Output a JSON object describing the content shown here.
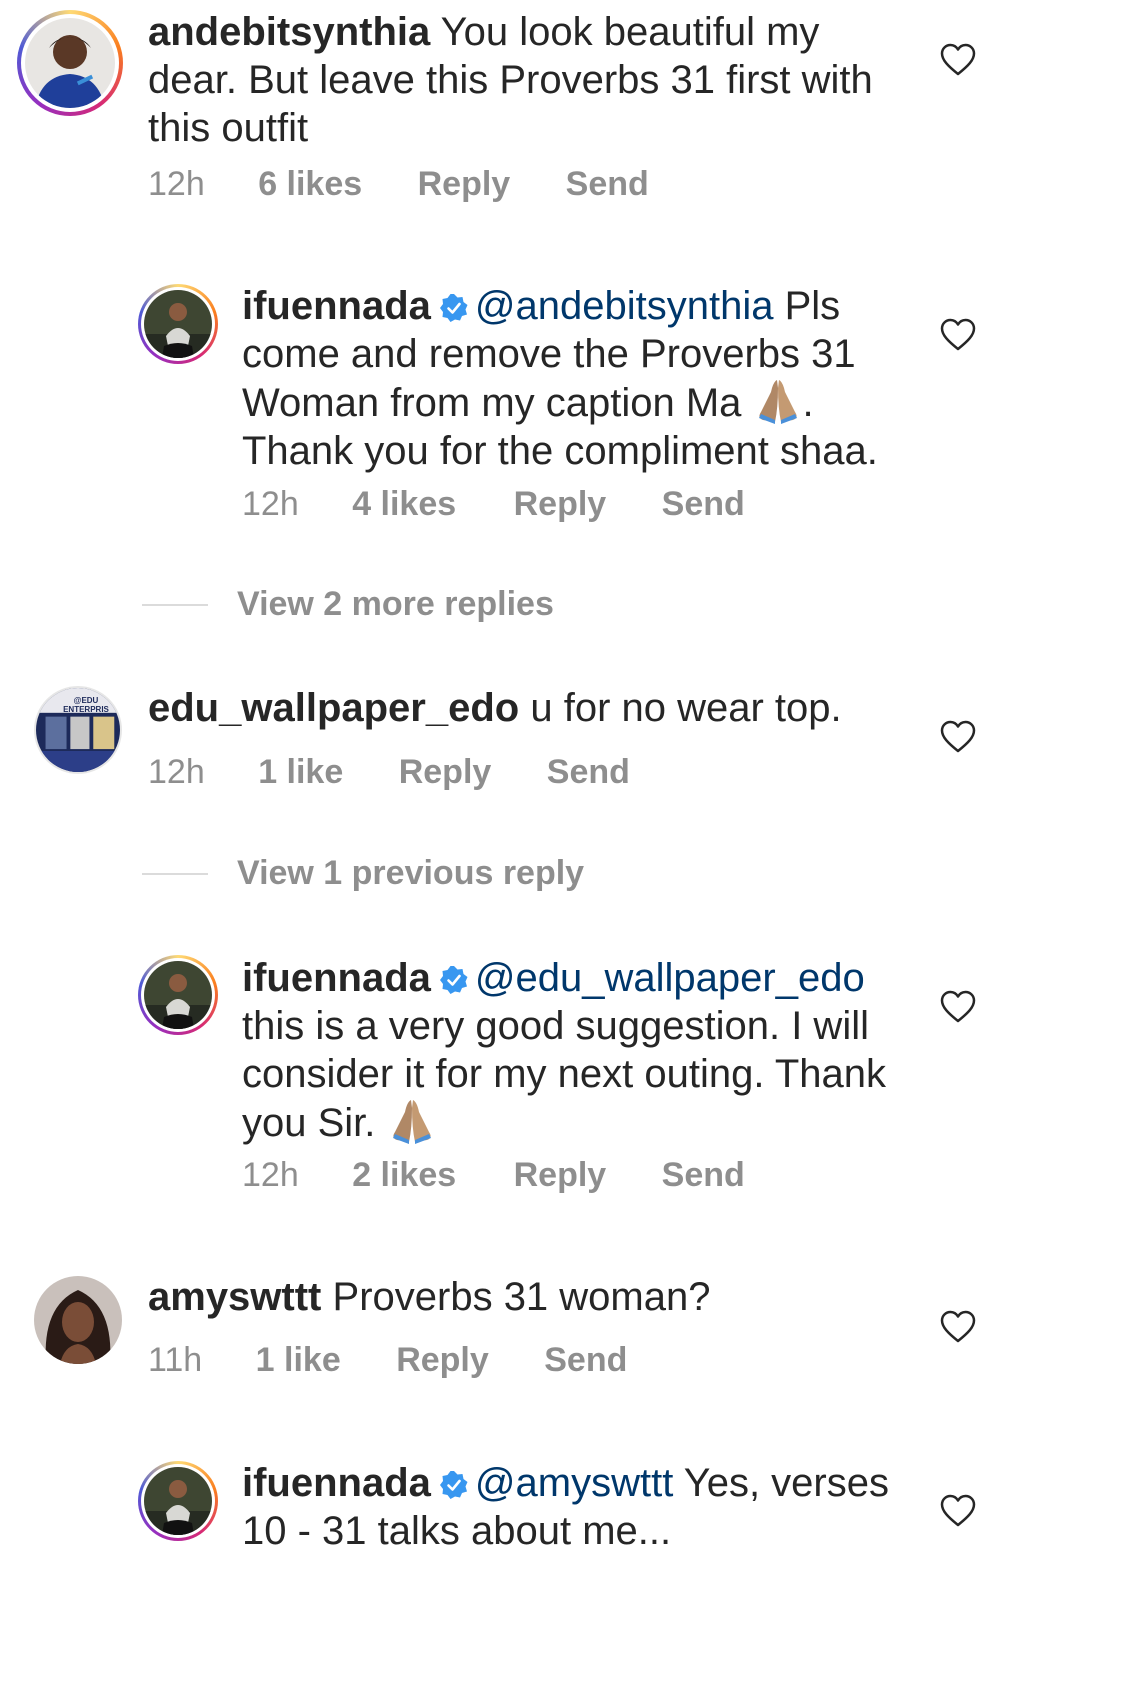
{
  "comments": [
    {
      "username": "andebitsynthia",
      "text": "You look beautiful my dear. But leave this Proverbs 31 first with this outfit",
      "time": "12h",
      "likes": "6 likes",
      "reply": "Reply",
      "send": "Send"
    },
    {
      "username": "ifuennada",
      "mention": "@andebitsynthia",
      "text_a": "Pls come and remove the Proverbs 31 Woman from my caption Ma",
      "text_b": ". Thank you for the compliment shaa.",
      "time": "12h",
      "likes": "4 likes",
      "reply": "Reply",
      "send": "Send"
    },
    {
      "view_more": "View 2 more replies"
    },
    {
      "username": "edu_wallpaper_edo",
      "text": "u for no wear top.",
      "time": "12h",
      "likes": "1 like",
      "reply": "Reply",
      "send": "Send",
      "avatar_text": "@EDU ENTERPRIS"
    },
    {
      "view_previous": "View 1 previous reply"
    },
    {
      "username": "ifuennada",
      "mention": "@edu_wallpaper_edo",
      "text": "this is a very good suggestion. I will consider it for my next outing. Thank you Sir.",
      "time": "12h",
      "likes": "2 likes",
      "reply": "Reply",
      "send": "Send"
    },
    {
      "username": "amyswttt",
      "text": "Proverbs 31 woman?",
      "time": "11h",
      "likes": "1 like",
      "reply": "Reply",
      "send": "Send"
    },
    {
      "username": "ifuennada",
      "mention": "@amyswttt",
      "text": "Yes, verses 10 - 31 talks about me..."
    }
  ],
  "colors": {
    "text": "#262626",
    "secondary": "#8e8e8e",
    "mention": "#00376b",
    "verified": "#3897f0"
  },
  "icons": [
    "heart-outline-icon",
    "verified-badge-icon",
    "folded-hands-emoji"
  ]
}
